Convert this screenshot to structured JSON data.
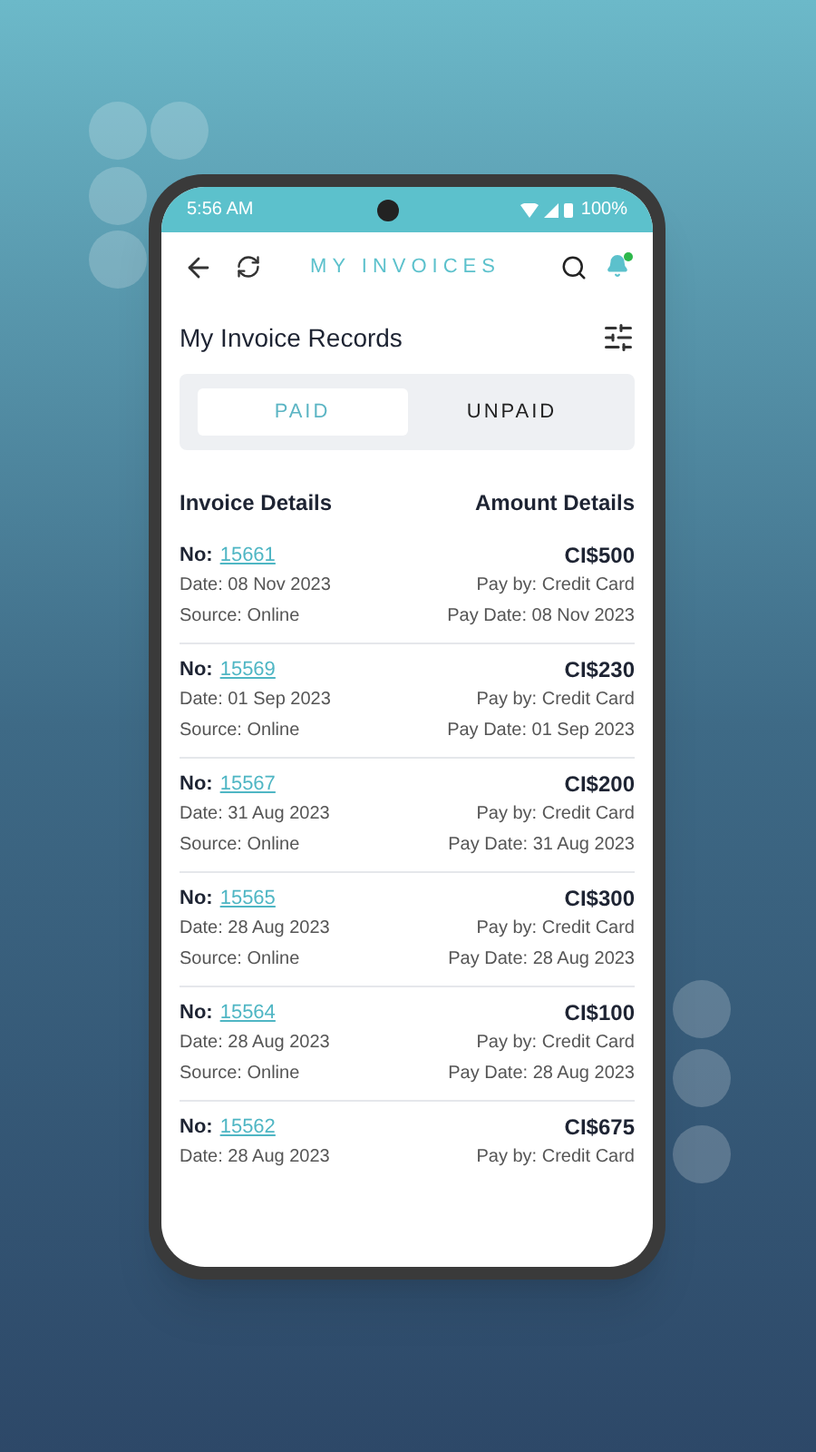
{
  "status_bar": {
    "time": "5:56 AM",
    "battery": "100%"
  },
  "app_bar": {
    "title": "MY INVOICES",
    "notification_dot": true
  },
  "page_title": "My Invoice Records",
  "tabs": [
    {
      "label": "PAID",
      "selected": true
    },
    {
      "label": "UNPAID",
      "selected": false
    }
  ],
  "columns": [
    "Invoice Details",
    "Amount Details"
  ],
  "invoices": [
    {
      "no_label": "No:",
      "number": "15661",
      "date": "Date: 08 Nov 2023",
      "source": "Source: Online",
      "amount": "CI$500",
      "pay_by": "Pay by: Credit Card",
      "pay_date": "Pay Date: 08 Nov 2023"
    },
    {
      "no_label": "No:",
      "number": "15569",
      "date": "Date: 01 Sep 2023",
      "source": "Source: Online",
      "amount": "CI$230",
      "pay_by": "Pay by: Credit Card",
      "pay_date": "Pay Date: 01 Sep 2023"
    },
    {
      "no_label": "No:",
      "number": "15567",
      "date": "Date: 31 Aug 2023",
      "source": "Source: Online",
      "amount": "CI$200",
      "pay_by": "Pay by: Credit Card",
      "pay_date": "Pay Date: 31 Aug 2023"
    },
    {
      "no_label": "No:",
      "number": "15565",
      "date": "Date: 28 Aug 2023",
      "source": "Source: Online",
      "amount": "CI$300",
      "pay_by": "Pay by: Credit Card",
      "pay_date": "Pay Date: 28 Aug 2023"
    },
    {
      "no_label": "No:",
      "number": "15564",
      "date": "Date: 28 Aug 2023",
      "source": "Source: Online",
      "amount": "CI$100",
      "pay_by": "Pay by: Credit Card",
      "pay_date": "Pay Date: 28 Aug 2023"
    },
    {
      "no_label": "No:",
      "number": "15562",
      "date": "Date: 28 Aug 2023",
      "amount": "CI$675",
      "pay_by": "Pay by: Credit Card"
    }
  ]
}
